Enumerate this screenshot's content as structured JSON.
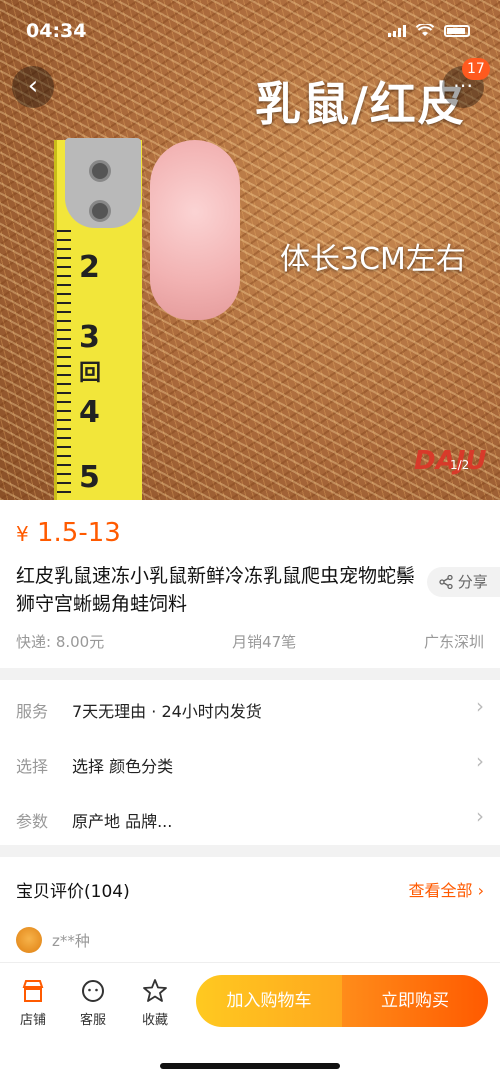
{
  "status_bar": {
    "time": "04:34"
  },
  "hero": {
    "overlay_title": "乳鼠/红皮",
    "overlay_subtitle": "体长3CM左右",
    "watermark": "DAJU",
    "pager": "1/2",
    "ruler_numbers": [
      "2",
      "3",
      "4",
      "5"
    ],
    "ruler_label": "回",
    "back_icon": "chevron-left-icon",
    "more_icon": "more-icon",
    "badge_count": "17"
  },
  "product": {
    "currency": "¥",
    "price": "1.5-13",
    "title": "红皮乳鼠速冻小乳鼠新鲜冷冻乳鼠爬虫宠物蛇鬃狮守宫蜥蜴角蛙饲料",
    "share_label": "分享",
    "shipping": "快递: 8.00元",
    "monthly_sales": "月销47笔",
    "location": "广东深圳"
  },
  "service_rows": [
    {
      "label": "服务",
      "value": "7天无理由 · 24小时内发货"
    },
    {
      "label": "选择",
      "value": "选择  颜色分类"
    },
    {
      "label": "参数",
      "value": "原产地 品牌..."
    }
  ],
  "reviews": {
    "header": "宝贝评价(104)",
    "view_all": "查看全部",
    "first_user": "z**种"
  },
  "bottom_bar": {
    "shop_label": "店铺",
    "service_label": "客服",
    "favorite_label": "收藏",
    "cart_button": "加入购物车",
    "buy_button": "立即购买"
  },
  "colors": {
    "accent": "#ff5a00",
    "cart_gradient_start": "#ffc920",
    "buy_gradient_end": "#ff5a00"
  }
}
